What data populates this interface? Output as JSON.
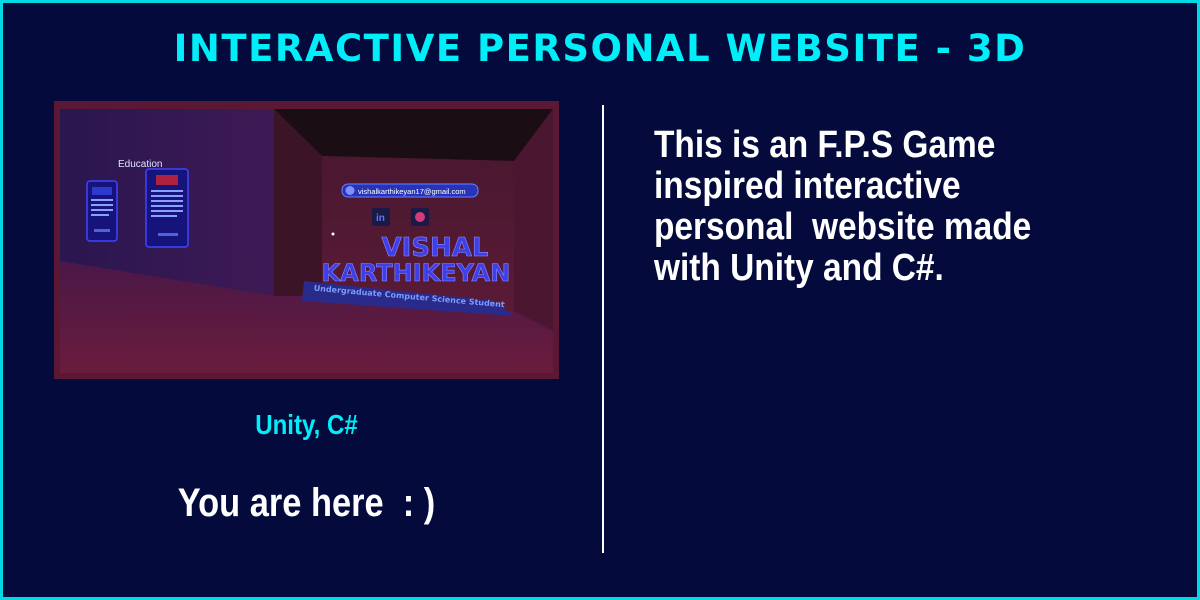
{
  "title": "INTERACTIVE PERSONAL WEBSITE - 3D",
  "screenshot": {
    "wall_heading": "Education",
    "email": "vishalkarthikeyan17@gmail.com",
    "name_line1": "VISHAL",
    "name_line2": "KARTHIKEYAN",
    "subtitle": "Undergraduate Computer Science Student",
    "linkedin_glyph": "in"
  },
  "tech_stack": "Unity, C#",
  "status": "You are here  : )",
  "description": "This is an F.P.S Game\ninspired interactive\npersonal  website made\nwith Unity and C#.",
  "colors": {
    "accent": "#00eef8",
    "background": "#040a3c",
    "text": "#ffffff"
  }
}
